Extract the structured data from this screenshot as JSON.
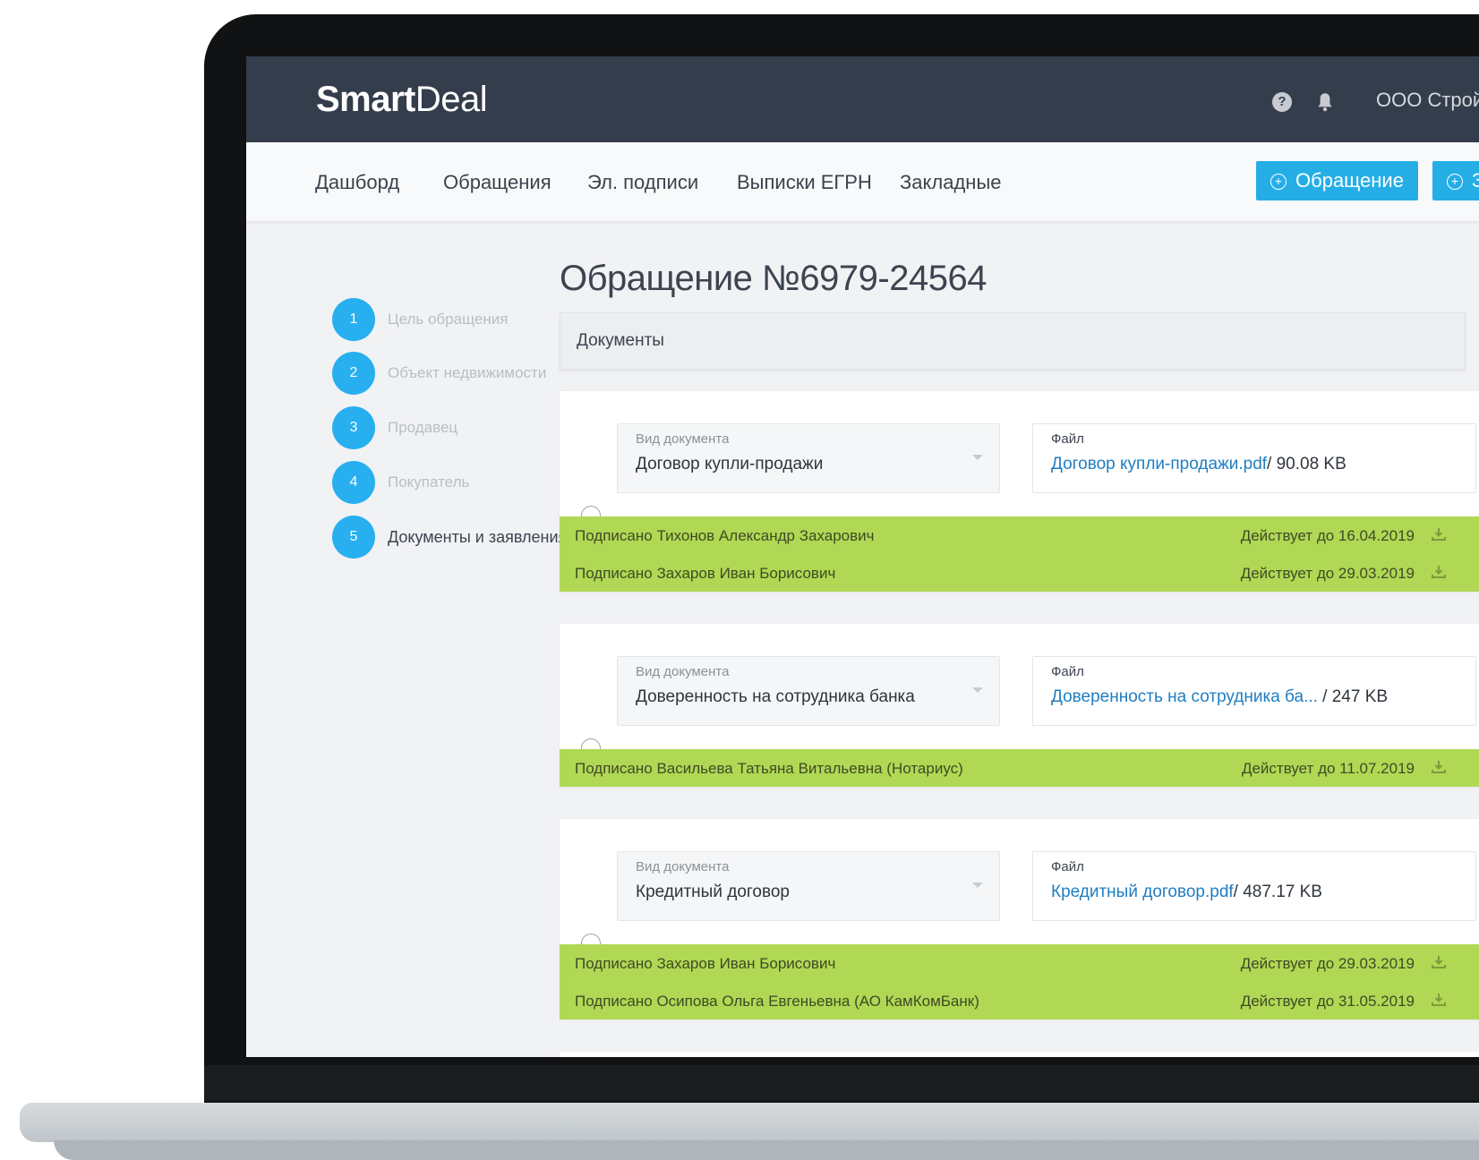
{
  "header": {
    "logo_bold": "Smart",
    "logo_light": "Deal",
    "company": "ООО СтройД",
    "help_icon_glyph": "?"
  },
  "nav": {
    "items": [
      "Дашборд",
      "Обращения",
      "Эл. подписи",
      "Выписки ЕГРН",
      "Закладные"
    ],
    "btn_new_appeal": "Обращение",
    "btn_second": "З",
    "accent_color": "#25aee6"
  },
  "page": {
    "title": "Обращение №6979-24564",
    "section_header": "Документы"
  },
  "steps": [
    {
      "num": "1",
      "label": "Цель обращения"
    },
    {
      "num": "2",
      "label": "Объект недвижимости"
    },
    {
      "num": "3",
      "label": "Продавец"
    },
    {
      "num": "4",
      "label": "Покупатель"
    },
    {
      "num": "5",
      "label": "Документы и заявления"
    }
  ],
  "documents": [
    {
      "type_label": "Вид документа",
      "type_value": "Договор купли-продажи",
      "file_label": "Файл",
      "file_name": "Договор купли-продажи.pdf",
      "file_size": "/ 90.08 KB",
      "signatures": [
        {
          "text": "Подписано Тихонов Александр Захарович",
          "valid": "Действует до 16.04.2019"
        },
        {
          "text": "Подписано Захаров Иван Борисович",
          "valid": "Действует до 29.03.2019"
        }
      ]
    },
    {
      "type_label": "Вид документа",
      "type_value": "Доверенность на сотрудника банка",
      "file_label": "Файл",
      "file_name": "Доверенность на сотрудника ба...",
      "file_size": " / 247 KB",
      "signatures": [
        {
          "text": "Подписано Васильева Татьяна Витальевна (Нотариус)",
          "valid": "Действует до 11.07.2019"
        }
      ]
    },
    {
      "type_label": "Вид документа",
      "type_value": "Кредитный договор",
      "file_label": "Файл",
      "file_name": "Кредитный договор.pdf",
      "file_size": "/ 487.17 KB",
      "signatures": [
        {
          "text": "Подписано Захаров Иван Борисович",
          "valid": "Действует до 29.03.2019"
        },
        {
          "text": "Подписано Осипова Ольга Евгеньевна (АО КамКомБанк)",
          "valid": "Действует до 31.05.2019"
        }
      ]
    }
  ],
  "colors": {
    "header_bg": "#343d4b",
    "step_circle": "#27aff0",
    "signed_bg": "#b0d854",
    "link": "#1f7ec2"
  }
}
